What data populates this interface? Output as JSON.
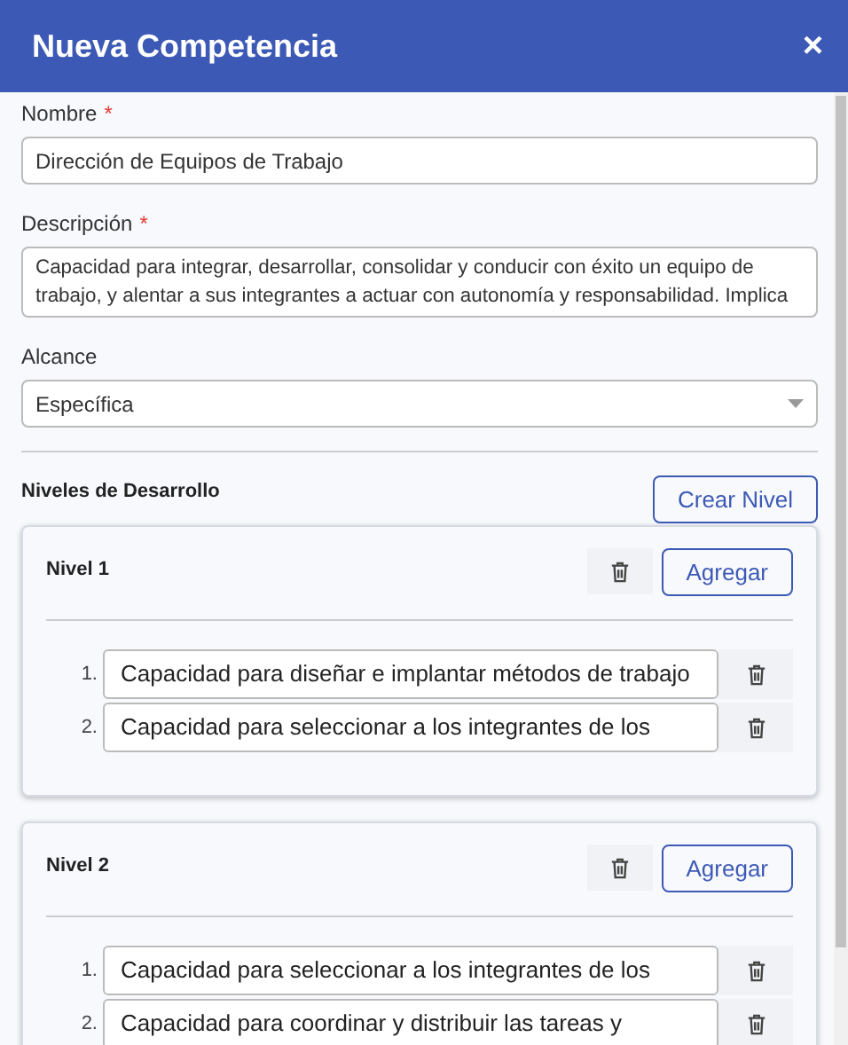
{
  "dialog": {
    "title": "Nueva Competencia",
    "close": "×"
  },
  "fields": [
    {
      "kind": "input",
      "label": "Nombre",
      "required_mark": "*",
      "value": "Dirección de Equipos de Trabajo"
    },
    {
      "kind": "textarea",
      "label": "Descripción",
      "required_mark": "*",
      "value": "Capacidad para integrar, desarrollar, consolidar y conducir con éxito un equipo de trabajo, y alentar a sus integrantes a actuar con autonomía y responsabilidad. Implica"
    },
    {
      "kind": "select",
      "label": "Alcance",
      "value": "Específica"
    }
  ],
  "levels_section": {
    "title": "Niveles de Desarrollo",
    "create_button": "Crear Nivel"
  },
  "levels": [
    {
      "title": "Nivel 1",
      "add_button": "Agregar",
      "items": [
        {
          "number": "1.",
          "text": "Capacidad para diseñar e implantar métodos de trabajo"
        },
        {
          "number": "2.",
          "text": "Capacidad para seleccionar a los integrantes de los"
        }
      ]
    },
    {
      "title": "Nivel 2",
      "add_button": "Agregar",
      "items": [
        {
          "number": "1.",
          "text": "Capacidad para seleccionar a los integrantes de los"
        },
        {
          "number": "2.",
          "text": "Capacidad para coordinar y distribuir las tareas y"
        }
      ]
    }
  ]
}
